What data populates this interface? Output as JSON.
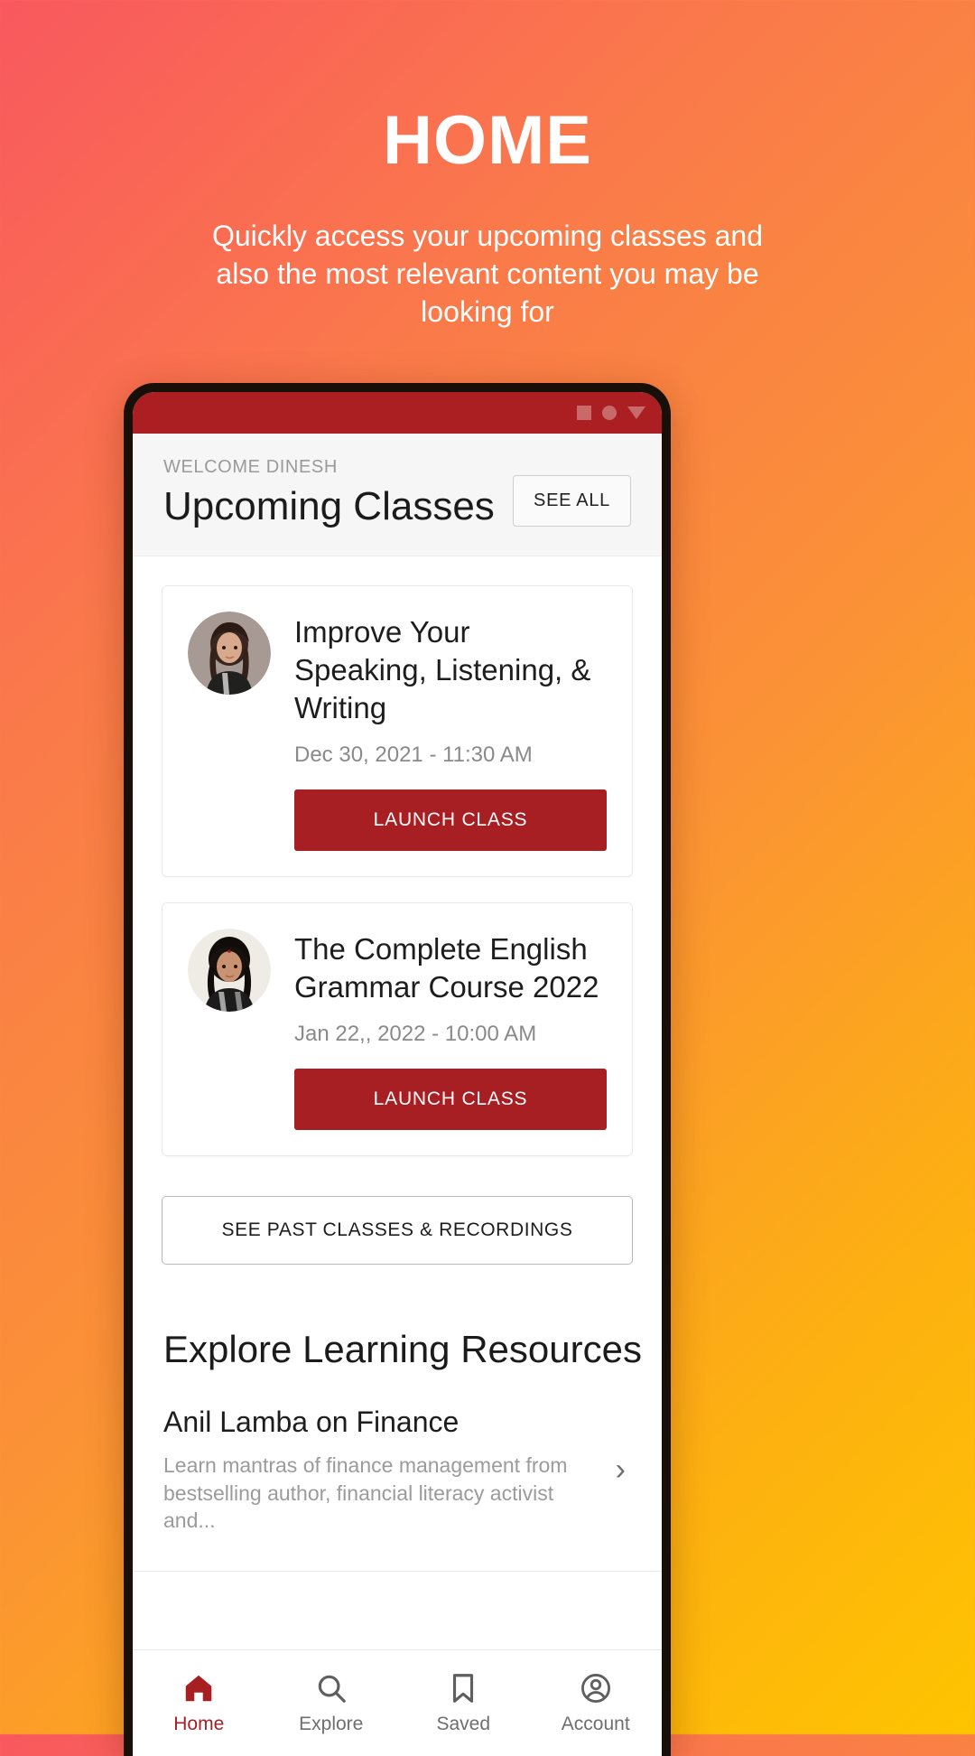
{
  "promo": {
    "title": "HOME",
    "subtitle": "Quickly access your upcoming classes and also the most relevant content you may be looking for"
  },
  "theme": {
    "brand_red": "#a81f23",
    "status_bar": "#ab1e22",
    "gradient_start": "#f9585e",
    "gradient_end": "#fec400"
  },
  "statusbar": {
    "icons": [
      "stop-square-icon",
      "circle-icon",
      "triangle-down-icon"
    ]
  },
  "app_header": {
    "welcome": "WELCOME DINESH",
    "title": "Upcoming Classes",
    "see_all": "SEE ALL"
  },
  "classes": [
    {
      "title": "Improve Your Speaking, Listening, & Writing",
      "datetime": "Dec 30, 2021 - 11:30 AM",
      "button": "LAUNCH CLASS",
      "avatar": "instructor-avatar"
    },
    {
      "title": "The Complete English Grammar Course 2022",
      "datetime": "Jan 22,, 2022 - 10:00 AM",
      "button": "LAUNCH CLASS",
      "avatar": "instructor-avatar"
    }
  ],
  "past_classes_button": "SEE PAST CLASSES & RECORDINGS",
  "explore": {
    "heading": "Explore Learning Resources",
    "items": [
      {
        "name": "Anil Lamba on Finance",
        "description": "Learn mantras of finance management from bestselling author, financial literacy activist and...",
        "chevron": "›"
      }
    ]
  },
  "bottom_nav": [
    {
      "label": "Home",
      "icon": "home-icon",
      "active": true
    },
    {
      "label": "Explore",
      "icon": "search-icon",
      "active": false
    },
    {
      "label": "Saved",
      "icon": "bookmark-icon",
      "active": false
    },
    {
      "label": "Account",
      "icon": "account-circle-icon",
      "active": false
    }
  ]
}
